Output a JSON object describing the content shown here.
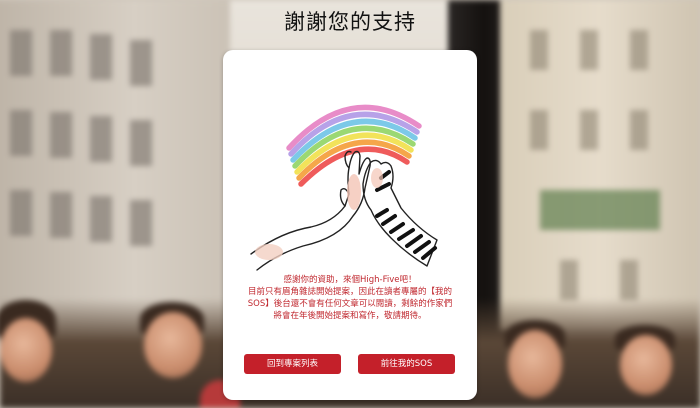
{
  "title": "謝謝您的支持",
  "card": {
    "message_lines": [
      "感謝你的資助，來個High-Five吧！",
      "目前只有眉角雜誌開始提案，因此在讀者專屬的【我的",
      "SOS】後台還不會有任何文章可以閱讀，剩餘的作家們",
      "將會在年後開始提案和寫作，敬請期待。"
    ],
    "buttons": {
      "back_label": "回到專案列表",
      "go_label": "前往我的SOS"
    },
    "illustration": "rainbow-high-five"
  },
  "colors": {
    "accent": "#c4202a",
    "message_text": "#c0282f",
    "rainbow": [
      "#e88cc8",
      "#b7a2e8",
      "#7cc9e8",
      "#9bd873",
      "#f2e35a",
      "#f5a64a",
      "#ef5b5b"
    ]
  }
}
